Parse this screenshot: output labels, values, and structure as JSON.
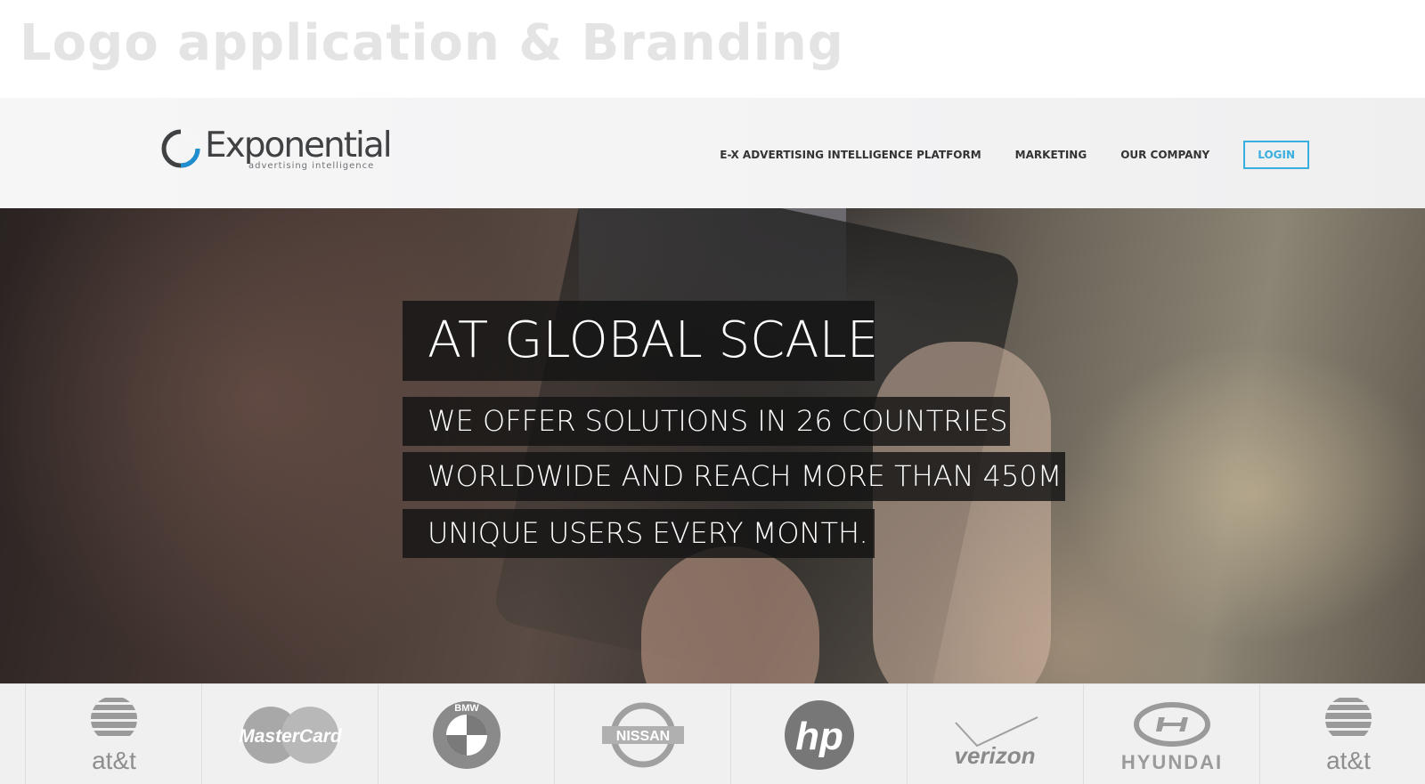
{
  "page": {
    "heading": "Logo application & Branding"
  },
  "header": {
    "logo": {
      "name": "Exponential",
      "tagline": "advertising intelligence"
    },
    "nav": [
      {
        "label": "E-X ADVERTISING INTELLIGENCE PLATFORM"
      },
      {
        "label": "MARKETING"
      },
      {
        "label": "OUR COMPANY"
      }
    ],
    "login_label": "LOGIN"
  },
  "hero": {
    "title": "AT GLOBAL SCALE",
    "lines": [
      "WE OFFER SOLUTIONS IN 26 COUNTRIES",
      "WORLDWIDE AND REACH MORE THAN 450M",
      "UNIQUE USERS EVERY MONTH."
    ]
  },
  "brands": [
    {
      "name": "at&t",
      "icon": "att-logo"
    },
    {
      "name": "MasterCard",
      "icon": "mastercard-logo"
    },
    {
      "name": "BMW",
      "icon": "bmw-logo"
    },
    {
      "name": "NISSAN",
      "icon": "nissan-logo"
    },
    {
      "name": "hp",
      "icon": "hp-logo"
    },
    {
      "name": "verizon",
      "icon": "verizon-logo"
    },
    {
      "name": "HYUNDAI",
      "icon": "hyundai-logo"
    },
    {
      "name": "at&t",
      "icon": "att-logo"
    }
  ],
  "colors": {
    "accent": "#3aaede",
    "logo_text": "#3f4143",
    "heading": "#e4e4e4",
    "caption_bg": "#141414"
  }
}
